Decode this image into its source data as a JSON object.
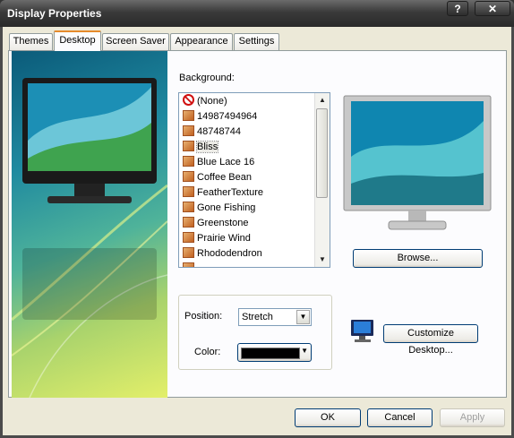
{
  "window": {
    "title": "Display Properties"
  },
  "titlebar_buttons": {
    "help": "?",
    "close": "✕"
  },
  "tabs": [
    "Themes",
    "Desktop",
    "Screen Saver",
    "Appearance",
    "Settings"
  ],
  "background": {
    "label": "Background:",
    "items": [
      "(None)",
      "14987494964",
      "48748744",
      "Bliss",
      "Blue Lace 16",
      "Coffee Bean",
      "FeatherTexture",
      "Gone Fishing",
      "Greenstone",
      "Prairie Wind",
      "Rhododendron"
    ],
    "selected": "Bliss"
  },
  "buttons": {
    "browse": "Browse...",
    "customize": "Customize Desktop...",
    "ok": "OK",
    "cancel": "Cancel",
    "apply": "Apply"
  },
  "position": {
    "label": "Position:",
    "value": "Stretch"
  },
  "color": {
    "label": "Color:",
    "swatch": "#000000"
  }
}
